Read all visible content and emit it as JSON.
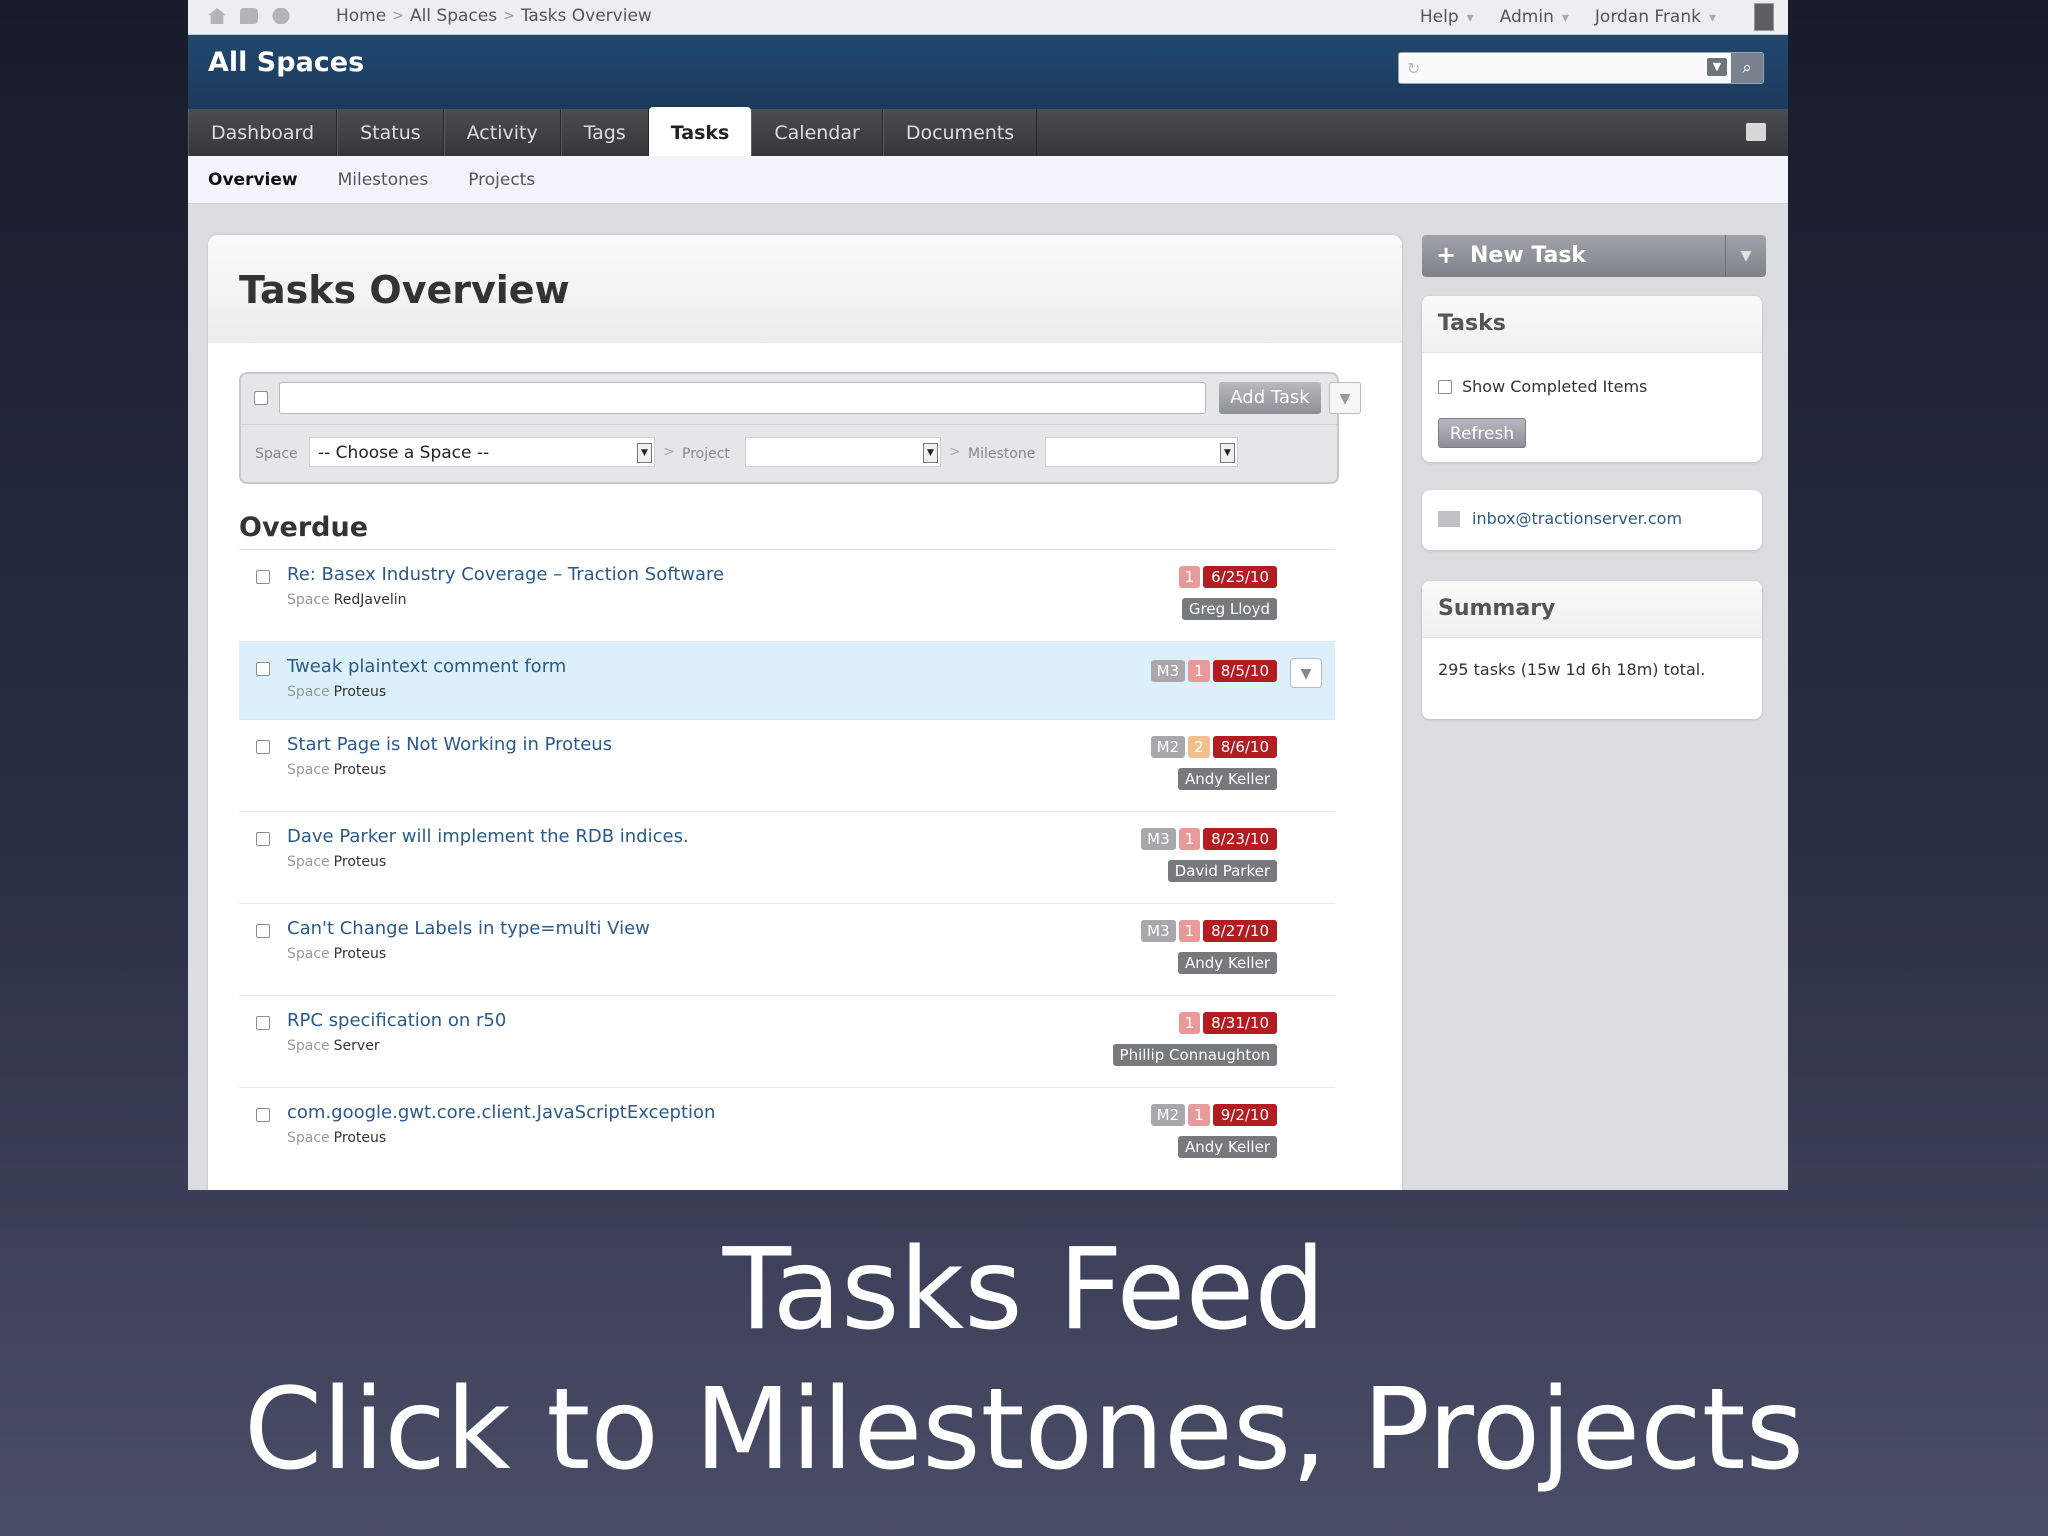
{
  "topbar": {
    "breadcrumb": [
      "Home",
      "All Spaces",
      "Tasks Overview"
    ],
    "menus": [
      "Help",
      "Admin",
      "Jordan Frank"
    ]
  },
  "header": {
    "space_title": "All Spaces",
    "search_placeholder": ""
  },
  "nav_tabs": [
    {
      "label": "Dashboard",
      "active": false
    },
    {
      "label": "Status",
      "active": false
    },
    {
      "label": "Activity",
      "active": false
    },
    {
      "label": "Tags",
      "active": false
    },
    {
      "label": "Tasks",
      "active": true
    },
    {
      "label": "Calendar",
      "active": false
    },
    {
      "label": "Documents",
      "active": false
    }
  ],
  "sub_tabs": [
    {
      "label": "Overview",
      "active": true
    },
    {
      "label": "Milestones",
      "active": false
    },
    {
      "label": "Projects",
      "active": false
    }
  ],
  "main": {
    "title": "Tasks Overview",
    "add_form": {
      "input_value": "",
      "add_button": "Add Task",
      "space_label": "Space",
      "space_value": "-- Choose a Space --",
      "project_label": "Project",
      "project_value": "",
      "milestone_label": "Milestone",
      "milestone_value": ""
    },
    "section_heading": "Overdue",
    "space_label": "Space",
    "tasks": [
      {
        "title": "Re: Basex Industry Coverage – Traction Software",
        "space": "RedJavelin",
        "milestone": "",
        "priority": "1",
        "due": "6/25/10",
        "assignee": "Greg Lloyd"
      },
      {
        "title": "Tweak plaintext comment form",
        "space": "Proteus",
        "milestone": "M3",
        "priority": "1",
        "due": "8/5/10",
        "assignee": ""
      },
      {
        "title": "Start Page is Not Working in Proteus",
        "space": "Proteus",
        "milestone": "M2",
        "priority": "2",
        "due": "8/6/10",
        "assignee": "Andy Keller"
      },
      {
        "title": "Dave Parker will implement the RDB indices.",
        "space": "Proteus",
        "milestone": "M3",
        "priority": "1",
        "due": "8/23/10",
        "assignee": "David Parker"
      },
      {
        "title": "Can't Change Labels in type=multi View",
        "space": "Proteus",
        "milestone": "M3",
        "priority": "1",
        "due": "8/27/10",
        "assignee": "Andy Keller"
      },
      {
        "title": "RPC specification on r50",
        "space": "Server",
        "milestone": "",
        "priority": "1",
        "due": "8/31/10",
        "assignee": "Phillip Connaughton"
      },
      {
        "title": "com.google.gwt.core.client.JavaScriptException",
        "space": "Proteus",
        "milestone": "M2",
        "priority": "1",
        "due": "9/2/10",
        "assignee": "Andy Keller"
      }
    ]
  },
  "sidebar": {
    "new_task_button": "New Task",
    "tasks_box": {
      "title": "Tasks",
      "show_completed_label": "Show Completed Items",
      "refresh_button": "Refresh"
    },
    "inbox_email": "inbox@tractionserver.com",
    "summary_box": {
      "title": "Summary",
      "text": "295 tasks (15w 1d 6h 18m) total."
    }
  },
  "caption": {
    "line1": "Tasks Feed",
    "line2": "Click to Milestones, Projects"
  }
}
